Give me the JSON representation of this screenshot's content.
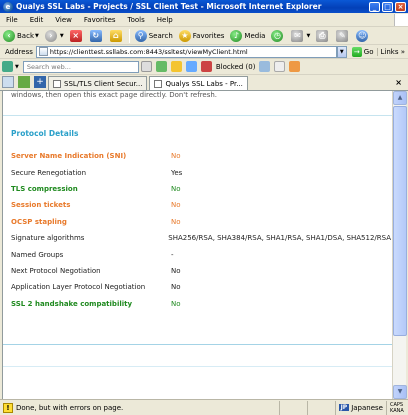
{
  "window": {
    "title": "Qualys SSL Labs - Projects / SSL Client Test - Microsoft Internet Explorer"
  },
  "menu": [
    "File",
    "Edit",
    "View",
    "Favorites",
    "Tools",
    "Help"
  ],
  "toolbar": {
    "back": "Back",
    "search": "Search",
    "favorites": "Favorites",
    "media": "Media"
  },
  "address": {
    "label": "Address",
    "url": "https://clienttest.ssllabs.com:8443/ssltest/viewMyClient.html",
    "go": "Go",
    "links": "Links"
  },
  "searchbar": {
    "placeholder": "Search web...",
    "blocked": "Blocked (0)"
  },
  "tabs": [
    {
      "label": "SSL/TLS Client Secur...",
      "active": false
    },
    {
      "label": "Qualys SSL Labs - Pr...",
      "active": true
    }
  ],
  "content": {
    "intro": "windows, then open this exact page directly. Don't refresh.",
    "section_title": "Protocol Details",
    "rows": [
      {
        "label": "Server Name Indication (SNI)",
        "value": "No",
        "label_color": "orange",
        "value_color": "orange"
      },
      {
        "label": "Secure Renegotiation",
        "value": "Yes",
        "label_color": "",
        "value_color": ""
      },
      {
        "label": "TLS compression",
        "value": "No",
        "label_color": "green",
        "value_color": "green"
      },
      {
        "label": "Session tickets",
        "value": "No",
        "label_color": "orange",
        "value_color": "orange"
      },
      {
        "label": "OCSP stapling",
        "value": "No",
        "label_color": "orange",
        "value_color": "orange"
      },
      {
        "label": "Signature algorithms",
        "value": "SHA256/RSA, SHA384/RSA, SHA1/RSA, SHA1/DSA, SHA512/RSA",
        "label_color": "",
        "value_color": ""
      },
      {
        "label": "Named Groups",
        "value": "-",
        "label_color": "",
        "value_color": ""
      },
      {
        "label": "Next Protocol Negotiation",
        "value": "No",
        "label_color": "",
        "value_color": ""
      },
      {
        "label": "Application Layer Protocol Negotiation",
        "value": "No",
        "label_color": "",
        "value_color": ""
      },
      {
        "label": "SSL 2 handshake compatibility",
        "value": "No",
        "label_color": "green",
        "value_color": "green"
      }
    ]
  },
  "status": {
    "text": "Done, but with errors on page.",
    "language_badge": "JP",
    "language": "Japanese",
    "corner": "CAPS KANA"
  },
  "colors": {
    "section_title": "#2aa0c9",
    "warning": "#e8792a",
    "good": "#1f8a1f",
    "titlebar": "#0a58d6"
  }
}
